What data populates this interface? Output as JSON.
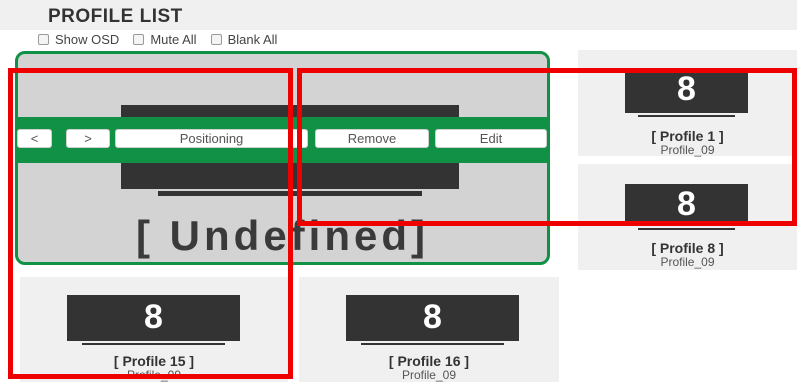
{
  "header": {
    "title": "PROFILE LIST"
  },
  "options": [
    {
      "label": "Show OSD",
      "checked": false
    },
    {
      "label": "Mute All",
      "checked": false
    },
    {
      "label": "Blank All",
      "checked": false
    }
  ],
  "selected_tile": {
    "label": "[ Undefined]",
    "toolbar": {
      "prev_label": "<",
      "next_label": ">",
      "positioning_label": "Positioning",
      "remove_label": "Remove",
      "edit_label": "Edit"
    }
  },
  "profiles": [
    {
      "number": "8",
      "name": "[ Profile 1 ]",
      "sub": "Profile_09"
    },
    {
      "number": "8",
      "name": "[ Profile 8 ]",
      "sub": "Profile_09"
    },
    {
      "number": "8",
      "name": "[ Profile 15 ]",
      "sub": "Profile_09"
    },
    {
      "number": "8",
      "name": "[ Profile 16 ]",
      "sub": "Profile_09"
    }
  ],
  "colors": {
    "accent": "#119146",
    "highlight": "#ee0000",
    "tile_bg": "#f0f0f0"
  }
}
